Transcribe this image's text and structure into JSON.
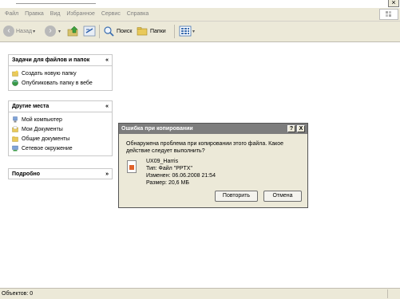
{
  "menu": {
    "items": [
      "Файл",
      "Правка",
      "Вид",
      "Избранное",
      "Сервис",
      "Справка"
    ]
  },
  "toolbar": {
    "back_label": "Назад",
    "search_label": "Поиск",
    "folders_label": "Папки"
  },
  "tasks_panel": {
    "title": "Задачи для файлов и папок",
    "items": [
      "Создать новую папку",
      "Опубликовать папку в вебе"
    ]
  },
  "places_panel": {
    "title": "Другие места",
    "items": [
      "Мой компьютер",
      "Мои Документы",
      "Общие документы",
      "Сетевое окружение"
    ]
  },
  "details_panel": {
    "title": "Подробно"
  },
  "dialog": {
    "title": "Ошибка при копировании",
    "help_glyph": "?",
    "close_glyph": "X",
    "message_line1": "Обнаружена проблема при копировании этого файла. Какое",
    "message_line2": "действие следует выполнить?",
    "file_name": "UX09_Harris",
    "file_type": "Тип: Файл \"PPTX\"",
    "file_modified": "Изменен: 06.06.2008 21:54",
    "file_size": "Размер: 20,6 МБ",
    "retry_label": "Повторить",
    "cancel_label": "Отмена"
  },
  "status": {
    "text": "Объектов: 0"
  },
  "colors": {
    "chrome": "#ece9d8",
    "dialog_title_bg": "#7d7d7d"
  }
}
